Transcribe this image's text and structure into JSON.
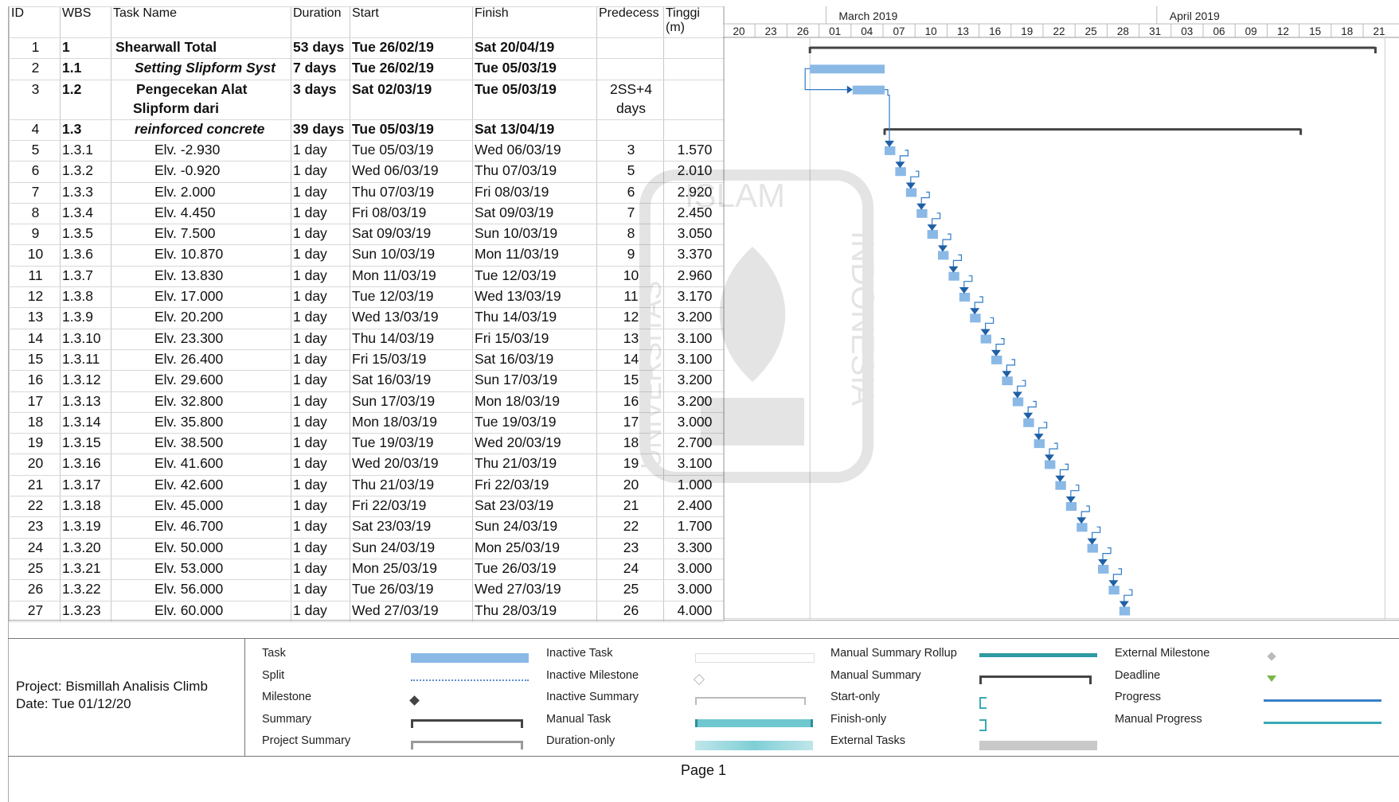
{
  "columns": {
    "id": "ID",
    "wbs": "WBS",
    "name": "Task Name",
    "duration": "Duration",
    "start": "Start",
    "finish": "Finish",
    "pred": "Predecess",
    "tinggi_1": "Tinggi",
    "tinggi_2": "(m)"
  },
  "timescale": {
    "months": [
      "March 2019",
      "April 2019"
    ],
    "days": [
      "20",
      "23",
      "26",
      "01",
      "04",
      "07",
      "10",
      "13",
      "16",
      "19",
      "22",
      "25",
      "28",
      "31",
      "03",
      "06",
      "09",
      "12",
      "15",
      "18",
      "21"
    ]
  },
  "tasks": [
    {
      "id": "1",
      "wbs": "1",
      "name": "Shearwall Total",
      "duration": "53 days",
      "start": "Tue 26/02/19",
      "finish": "Sat 20/04/19",
      "pred": "",
      "tinggi": "",
      "style": "summary"
    },
    {
      "id": "2",
      "wbs": "1.1",
      "name": "Setting Slipform Syst",
      "duration": "7 days",
      "start": "Tue 26/02/19",
      "finish": "Tue 05/03/19",
      "pred": "",
      "tinggi": "",
      "style": "bi"
    },
    {
      "id": "3",
      "wbs": "1.2",
      "name": "Pengecekan Alat",
      "name2": "Slipform dari",
      "duration": "3 days",
      "start": "Sat 02/03/19",
      "finish": "Tue 05/03/19",
      "pred": "2SS+4",
      "pred2": "days",
      "tinggi": "",
      "style": "bold"
    },
    {
      "id": "4",
      "wbs": "1.3",
      "name": "reinforced concrete",
      "duration": "39 days",
      "start": "Tue 05/03/19",
      "finish": "Sat 13/04/19",
      "pred": "",
      "tinggi": "",
      "style": "bi"
    },
    {
      "id": "5",
      "wbs": "1.3.1",
      "name": "Elv. -2.930",
      "duration": "1 day",
      "start": "Tue 05/03/19",
      "finish": "Wed 06/03/19",
      "pred": "3",
      "tinggi": "1.570"
    },
    {
      "id": "6",
      "wbs": "1.3.2",
      "name": "Elv. -0.920",
      "duration": "1 day",
      "start": "Wed 06/03/19",
      "finish": "Thu 07/03/19",
      "pred": "5",
      "tinggi": "2.010"
    },
    {
      "id": "7",
      "wbs": "1.3.3",
      "name": "Elv. 2.000",
      "duration": "1 day",
      "start": "Thu 07/03/19",
      "finish": "Fri 08/03/19",
      "pred": "6",
      "tinggi": "2.920"
    },
    {
      "id": "8",
      "wbs": "1.3.4",
      "name": "Elv. 4.450",
      "duration": "1 day",
      "start": "Fri 08/03/19",
      "finish": "Sat 09/03/19",
      "pred": "7",
      "tinggi": "2.450"
    },
    {
      "id": "9",
      "wbs": "1.3.5",
      "name": "Elv. 7.500",
      "duration": "1 day",
      "start": "Sat 09/03/19",
      "finish": "Sun 10/03/19",
      "pred": "8",
      "tinggi": "3.050"
    },
    {
      "id": "10",
      "wbs": "1.3.6",
      "name": "Elv. 10.870",
      "duration": "1 day",
      "start": "Sun 10/03/19",
      "finish": "Mon 11/03/19",
      "pred": "9",
      "tinggi": "3.370"
    },
    {
      "id": "11",
      "wbs": "1.3.7",
      "name": "Elv. 13.830",
      "duration": "1 day",
      "start": "Mon 11/03/19",
      "finish": "Tue 12/03/19",
      "pred": "10",
      "tinggi": "2.960"
    },
    {
      "id": "12",
      "wbs": "1.3.8",
      "name": "Elv. 17.000",
      "duration": "1 day",
      "start": "Tue 12/03/19",
      "finish": "Wed 13/03/19",
      "pred": "11",
      "tinggi": "3.170"
    },
    {
      "id": "13",
      "wbs": "1.3.9",
      "name": "Elv. 20.200",
      "duration": "1 day",
      "start": "Wed 13/03/19",
      "finish": "Thu 14/03/19",
      "pred": "12",
      "tinggi": "3.200"
    },
    {
      "id": "14",
      "wbs": "1.3.10",
      "name": "Elv. 23.300",
      "duration": "1 day",
      "start": "Thu 14/03/19",
      "finish": "Fri 15/03/19",
      "pred": "13",
      "tinggi": "3.100"
    },
    {
      "id": "15",
      "wbs": "1.3.11",
      "name": "Elv. 26.400",
      "duration": "1 day",
      "start": "Fri 15/03/19",
      "finish": "Sat 16/03/19",
      "pred": "14",
      "tinggi": "3.100"
    },
    {
      "id": "16",
      "wbs": "1.3.12",
      "name": "Elv. 29.600",
      "duration": "1 day",
      "start": "Sat 16/03/19",
      "finish": "Sun 17/03/19",
      "pred": "15",
      "tinggi": "3.200"
    },
    {
      "id": "17",
      "wbs": "1.3.13",
      "name": "Elv. 32.800",
      "duration": "1 day",
      "start": "Sun 17/03/19",
      "finish": "Mon 18/03/19",
      "pred": "16",
      "tinggi": "3.200"
    },
    {
      "id": "18",
      "wbs": "1.3.14",
      "name": "Elv. 35.800",
      "duration": "1 day",
      "start": "Mon 18/03/19",
      "finish": "Tue 19/03/19",
      "pred": "17",
      "tinggi": "3.000"
    },
    {
      "id": "19",
      "wbs": "1.3.15",
      "name": "Elv. 38.500",
      "duration": "1 day",
      "start": "Tue 19/03/19",
      "finish": "Wed 20/03/19",
      "pred": "18",
      "tinggi": "2.700"
    },
    {
      "id": "20",
      "wbs": "1.3.16",
      "name": "Elv. 41.600",
      "duration": "1 day",
      "start": "Wed 20/03/19",
      "finish": "Thu 21/03/19",
      "pred": "19",
      "tinggi": "3.100"
    },
    {
      "id": "21",
      "wbs": "1.3.17",
      "name": "Elv. 42.600",
      "duration": "1 day",
      "start": "Thu 21/03/19",
      "finish": "Fri 22/03/19",
      "pred": "20",
      "tinggi": "1.000"
    },
    {
      "id": "22",
      "wbs": "1.3.18",
      "name": "Elv. 45.000",
      "duration": "1 day",
      "start": "Fri 22/03/19",
      "finish": "Sat 23/03/19",
      "pred": "21",
      "tinggi": "2.400"
    },
    {
      "id": "23",
      "wbs": "1.3.19",
      "name": "Elv. 46.700",
      "duration": "1 day",
      "start": "Sat 23/03/19",
      "finish": "Sun 24/03/19",
      "pred": "22",
      "tinggi": "1.700"
    },
    {
      "id": "24",
      "wbs": "1.3.20",
      "name": "Elv. 50.000",
      "duration": "1 day",
      "start": "Sun 24/03/19",
      "finish": "Mon 25/03/19",
      "pred": "23",
      "tinggi": "3.300"
    },
    {
      "id": "25",
      "wbs": "1.3.21",
      "name": "Elv. 53.000",
      "duration": "1 day",
      "start": "Mon 25/03/19",
      "finish": "Tue 26/03/19",
      "pred": "24",
      "tinggi": "3.000"
    },
    {
      "id": "26",
      "wbs": "1.3.22",
      "name": "Elv. 56.000",
      "duration": "1 day",
      "start": "Tue 26/03/19",
      "finish": "Wed 27/03/19",
      "pred": "25",
      "tinggi": "3.000"
    },
    {
      "id": "27",
      "wbs": "1.3.23",
      "name": "Elv. 60.000",
      "duration": "1 day",
      "start": "Wed 27/03/19",
      "finish": "Thu 28/03/19",
      "pred": "26",
      "tinggi": "4.000"
    }
  ],
  "project": {
    "line1": "Project: Bismillah Analisis Climb",
    "line2": "Date: Tue 01/12/20"
  },
  "legend": {
    "col1": [
      "Task",
      "Split",
      "Milestone",
      "Summary",
      "Project Summary"
    ],
    "col2": [
      "Inactive Task",
      "Inactive Milestone",
      "Inactive Summary",
      "Manual Task",
      "Duration-only"
    ],
    "col3": [
      "Manual Summary Rollup",
      "Manual Summary",
      "Start-only",
      "Finish-only",
      "External Tasks"
    ],
    "col4": [
      "External Milestone",
      "Deadline",
      "Progress",
      "Manual Progress"
    ]
  },
  "footer": {
    "page": "Page 1"
  },
  "watermark_text": [
    "ISLAM",
    "INDONESIA",
    "UNIVERSITAS"
  ],
  "colors": {
    "task_bar": "#8ab9e6",
    "summary_bar": "#444444",
    "link": "#2e7bc8",
    "manual": "#3aaab5"
  }
}
